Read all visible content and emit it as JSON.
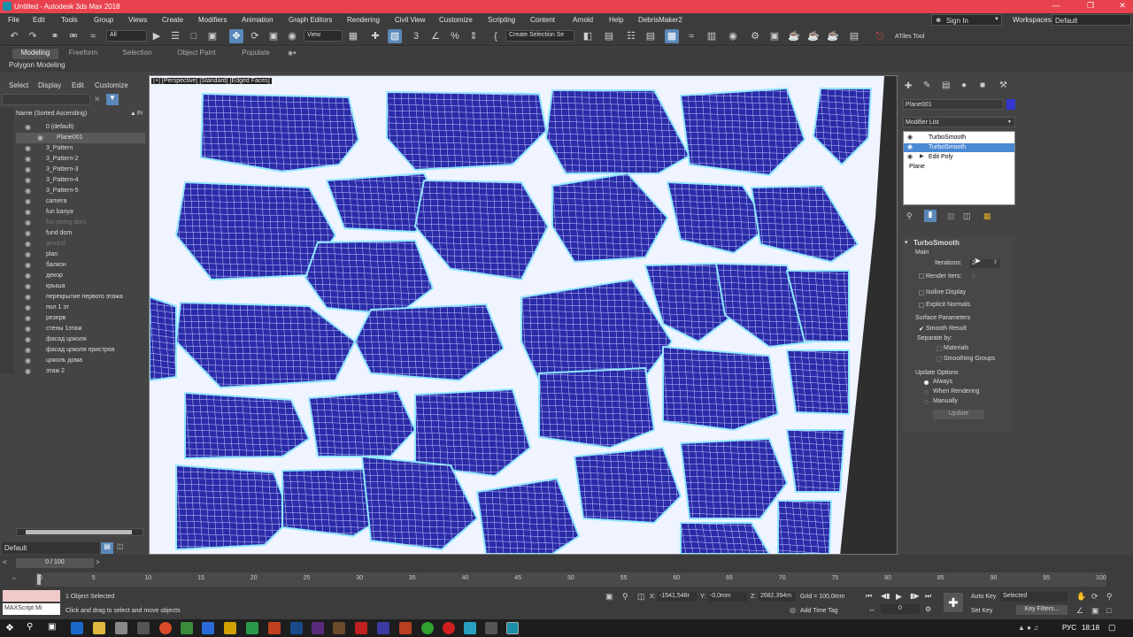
{
  "window": {
    "title": "Untitled - Autodesk 3ds Max 2018"
  },
  "menu": [
    "File",
    "Edit",
    "Tools",
    "Group",
    "Views",
    "Create",
    "Modifiers",
    "Animation",
    "Graph Editors",
    "Rendering",
    "Civil View",
    "Customize",
    "Scripting",
    "Content",
    "Arnold",
    "Help",
    "DebrisMaker2"
  ],
  "account": {
    "sign_in": "Sign In",
    "workspaces_label": "Workspaces:",
    "workspace": "Default"
  },
  "toolbar": {
    "filter": "All",
    "ref_coord": "View",
    "named_selection": "Create Selection Se",
    "atiles": "ATiles Tool"
  },
  "ribbon": {
    "tabs": [
      "Modeling",
      "Freeform",
      "Selection",
      "Object Paint",
      "Populate"
    ],
    "sub": "Polygon Modeling"
  },
  "scene_explorer": {
    "tabs": [
      "Select",
      "Display",
      "Edit",
      "Customize"
    ],
    "sort_label": "Name (Sorted Ascending)",
    "fr": "Fr",
    "items": [
      {
        "name": "0 (default)",
        "dim": false
      },
      {
        "name": "Plane001",
        "dim": false,
        "selected": true
      },
      {
        "name": "3_Pattern",
        "dim": false
      },
      {
        "name": "3_Pattern-2",
        "dim": false
      },
      {
        "name": "3_Pattern-3",
        "dim": false
      },
      {
        "name": "3_Pattern-4",
        "dim": false
      },
      {
        "name": "3_Pattern-5",
        "dim": false
      },
      {
        "name": "camera",
        "dim": false
      },
      {
        "name": "fun banya",
        "dim": false
      },
      {
        "name": "fun pereg dom",
        "dim": true
      },
      {
        "name": "fund dom",
        "dim": false
      },
      {
        "name": "ground",
        "dim": true
      },
      {
        "name": "plan",
        "dim": false
      },
      {
        "name": "балкон",
        "dim": false
      },
      {
        "name": "декор",
        "dim": false
      },
      {
        "name": "крыша",
        "dim": false
      },
      {
        "name": "перекрытие первого этажа",
        "dim": false
      },
      {
        "name": "пол 1 эт",
        "dim": false
      },
      {
        "name": "резерв",
        "dim": false
      },
      {
        "name": "стены 1этаж",
        "dim": false
      },
      {
        "name": "фасад цоколя",
        "dim": false
      },
      {
        "name": "фасад цоколя пристроя",
        "dim": false
      },
      {
        "name": "цоколь дома",
        "dim": false
      },
      {
        "name": "этаж 2",
        "dim": false
      }
    ],
    "layer": "Default"
  },
  "viewport": {
    "label": "[+] [Perspective] [Standard] [Edged Faces]"
  },
  "command_panel": {
    "object_name": "Plane001",
    "modifier_list": "Modifier List",
    "stack": [
      "TurboSmooth",
      "TurboSmooth",
      "Edit Poly",
      "Plane"
    ],
    "rollout": {
      "title": "TurboSmooth",
      "main": "Main",
      "iterations_label": "Iterations:",
      "iterations": "2",
      "render_iters_label": "Render Iters:",
      "render_iters": "0",
      "isoline": "Isoline Display",
      "explicit": "Explicit Normals",
      "surface_params": "Surface Parameters",
      "smooth_result": "Smooth Result",
      "separate_by": "Separate by:",
      "materials": "Materials",
      "smoothing_groups": "Smoothing Groups",
      "update_options": "Update Options",
      "always": "Always",
      "when_rendering": "When Rendering",
      "manually": "Manually",
      "update": "Update"
    }
  },
  "timeline": {
    "frame": "0 / 100",
    "ticks": [
      "0",
      "5",
      "10",
      "15",
      "20",
      "25",
      "30",
      "35",
      "40",
      "45",
      "50",
      "55",
      "60",
      "65",
      "70",
      "75",
      "80",
      "85",
      "90",
      "95",
      "100"
    ]
  },
  "status": {
    "maxscript": "MAXScript Mi",
    "selected": "1 Object Selected",
    "prompt": "Click and drag to select and move objects",
    "x_label": "X:",
    "x": "-1541,548r",
    "y_label": "Y:",
    "y": "-0,0mm",
    "z_label": "Z:",
    "z": "2682,394m",
    "grid": "Grid = 100,0mm",
    "add_time_tag": "Add Time Tag",
    "auto_key": "Auto Key",
    "set_key": "Set Key",
    "selected_dd": "Selected",
    "key_filters": "Key Filters...",
    "frame_num": "0"
  },
  "taskbar": {
    "lang": "РУС",
    "time": "18:18"
  }
}
